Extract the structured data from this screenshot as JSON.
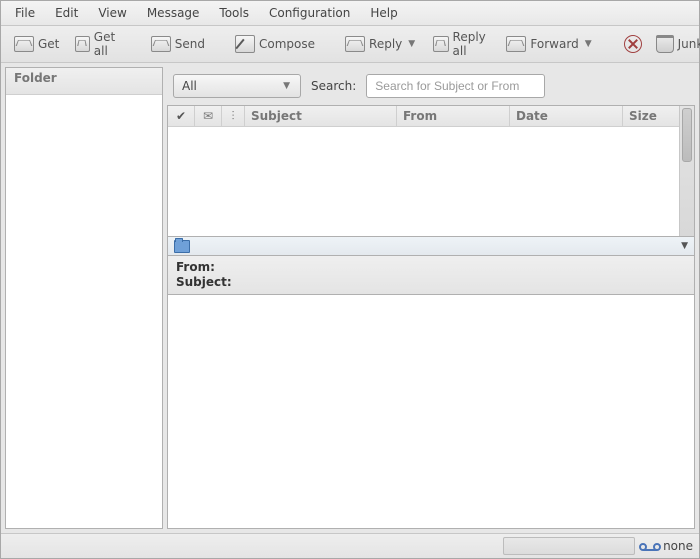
{
  "menu": {
    "items": [
      "File",
      "Edit",
      "View",
      "Message",
      "Tools",
      "Configuration",
      "Help"
    ]
  },
  "toolbar": {
    "get": "Get",
    "get_all": "Get all",
    "send": "Send",
    "compose": "Compose",
    "reply": "Reply",
    "reply_all": "Reply all",
    "forward": "Forward",
    "junk": "Junk"
  },
  "folder_panel": {
    "header": "Folder"
  },
  "filter": {
    "combo_value": "All",
    "search_label": "Search:",
    "search_placeholder": "Search for Subject or From"
  },
  "columns": {
    "flag": "✔",
    "icon": "✉",
    "attach": "⫶",
    "subject": "Subject",
    "from": "From",
    "date": "Date",
    "size": "Size"
  },
  "preview": {
    "from_label": "From:",
    "subject_label": "Subject:"
  },
  "status": {
    "connection": "none"
  }
}
